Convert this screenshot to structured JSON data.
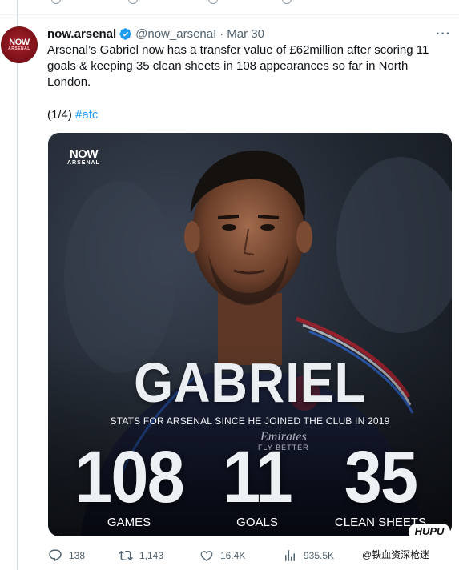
{
  "previous_tweet_actions": {
    "replies": "",
    "retweets": "",
    "likes": "",
    "views": ""
  },
  "tweet": {
    "author_name": "now.arsenal",
    "handle": "@now_arsenaI",
    "separator": "·",
    "date": "Mar 30",
    "more_label": "···",
    "text": "Arsenal’s Gabriel now has a transfer value of £62million after scoring 11 goals & keeping 35 clean sheets in 108 appearances so far in North London.",
    "thread_counter": "(1/4)",
    "hashtag": "#afc",
    "avatar": {
      "line1": "NOW",
      "line2": "ARSENAL"
    },
    "verified_color": "#1d9bf0"
  },
  "media": {
    "logo_line1": "NOW",
    "logo_line2": "ARSENAL",
    "player_name": "GABRIEL",
    "subtitle": "STATS FOR ARSENAL SINCE HE JOINED THE CLUB IN 2019",
    "sponsor_line1": "Emirates",
    "sponsor_line2": "FLY BETTER",
    "stats": [
      {
        "value": "108",
        "label": "GAMES"
      },
      {
        "value": "11",
        "label": "GOALS"
      },
      {
        "value": "35",
        "label": "CLEAN SHEETS"
      }
    ]
  },
  "actions": {
    "replies": "138",
    "retweets": "1,143",
    "likes": "16.4K",
    "views": "935.5K"
  },
  "watermarks": {
    "hupu": "HUPU",
    "author": "@铁血资深枪迷"
  },
  "colors": {
    "accent": "#1d9bf0",
    "text": "#0f1419",
    "muted": "#536471",
    "arsenal_red": "#a3202a"
  },
  "icons": [
    "reply-icon",
    "retweet-icon",
    "like-icon",
    "views-icon",
    "verified-icon",
    "more-icon"
  ]
}
